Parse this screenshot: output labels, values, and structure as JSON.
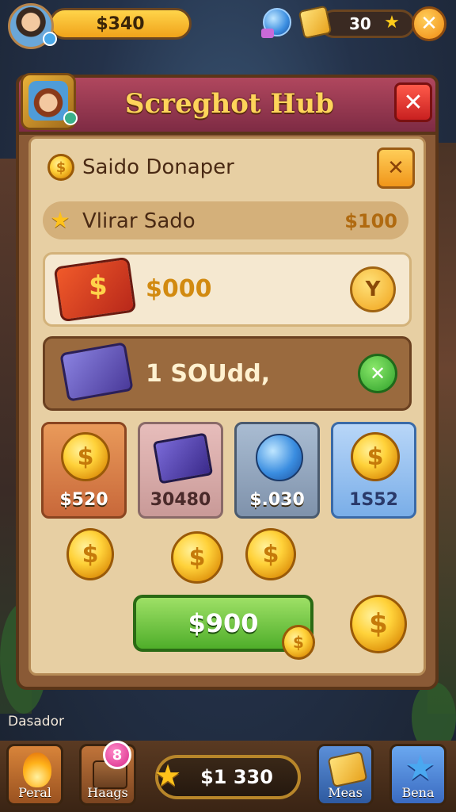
{
  "topbar": {
    "coin_balance": "$340",
    "gem_count": "30",
    "star_symbol": "★",
    "close_symbol": "✕"
  },
  "panel": {
    "title": "Screghot Hub",
    "close_symbol": "✕",
    "row1": {
      "label": "Saido Donaper",
      "close_symbol": "✕",
      "coin_symbol": "$"
    },
    "row2": {
      "label": "Vlirar Sado",
      "value": "$100",
      "star_symbol": "★"
    },
    "card1": {
      "value": "$000",
      "button_symbol": "Y",
      "icon_symbol": "$"
    },
    "card2": {
      "value": "1 SOUdd,",
      "button_symbol": "✕"
    },
    "tiles": [
      {
        "label": "$520"
      },
      {
        "label": "30480"
      },
      {
        "label": "$.030"
      },
      {
        "label": "1S52"
      }
    ],
    "coin_symbol": "$",
    "buy_button": "$900"
  },
  "bottom": {
    "side_label": "Dasador",
    "nav": [
      {
        "label": "Peral"
      },
      {
        "label": "Haags"
      },
      {
        "label": "Meas"
      },
      {
        "label": "Bena"
      }
    ],
    "badge_count": "8",
    "balance": "$1 330",
    "star_symbol": "★"
  },
  "colors": {
    "panel_header": "#9a3a54",
    "panel_inner": "#e7cfa3",
    "title_gold": "#ffd45a",
    "buy_green": "#6fc43a",
    "coin_gold": "#ffd23a"
  }
}
